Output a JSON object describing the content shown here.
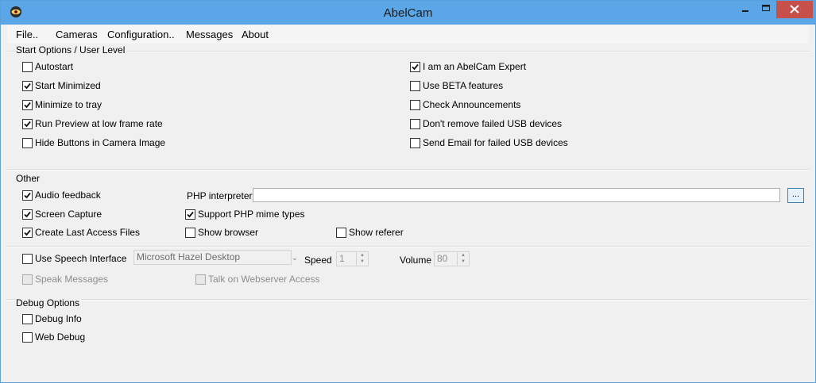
{
  "window": {
    "title": "AbelCam"
  },
  "menu": [
    "File..",
    "Cameras",
    "Configuration..",
    "Messages",
    "About"
  ],
  "start_options": {
    "label": "Start Options / User Level",
    "left": [
      {
        "label": "Autostart",
        "checked": false
      },
      {
        "label": "Start Minimized",
        "checked": true
      },
      {
        "label": "Minimize to tray",
        "checked": true
      },
      {
        "label": "Run Preview at low frame rate",
        "checked": true
      },
      {
        "label": "Hide Buttons in Camera Image",
        "checked": false
      }
    ],
    "right": [
      {
        "label": "I am an AbelCam Expert",
        "checked": true
      },
      {
        "label": "Use BETA features",
        "checked": false
      },
      {
        "label": "Check Announcements",
        "checked": false
      },
      {
        "label": "Don't remove failed USB devices",
        "checked": false
      },
      {
        "label": "Send Email for failed USB devices",
        "checked": false
      }
    ]
  },
  "other": {
    "label": "Other",
    "audio_feedback": {
      "label": "Audio feedback",
      "checked": true
    },
    "screen_capture": {
      "label": "Screen Capture",
      "checked": true
    },
    "create_last_access": {
      "label": "Create Last Access Files",
      "checked": true
    },
    "php_label": "PHP interpreter",
    "php_value": "",
    "browse_label": "...",
    "support_php_mime": {
      "label": "Support PHP mime types",
      "checked": true
    },
    "show_browser": {
      "label": "Show browser",
      "checked": false
    },
    "show_referer": {
      "label": "Show referer",
      "checked": false
    }
  },
  "speech": {
    "use_speech": {
      "label": "Use Speech Interface",
      "checked": false
    },
    "voice": "Microsoft Hazel Desktop",
    "speed_label": "Speed",
    "speed_value": "1",
    "volume_label": "Volume",
    "volume_value": "80",
    "speak_messages": {
      "label": "Speak Messages",
      "checked": false
    },
    "talk_webserver": {
      "label": "Talk on Webserver Access",
      "checked": false
    }
  },
  "debug": {
    "label": "Debug Options",
    "debug_info": {
      "label": "Debug Info",
      "checked": false
    },
    "web_debug": {
      "label": "Web Debug",
      "checked": false
    }
  }
}
